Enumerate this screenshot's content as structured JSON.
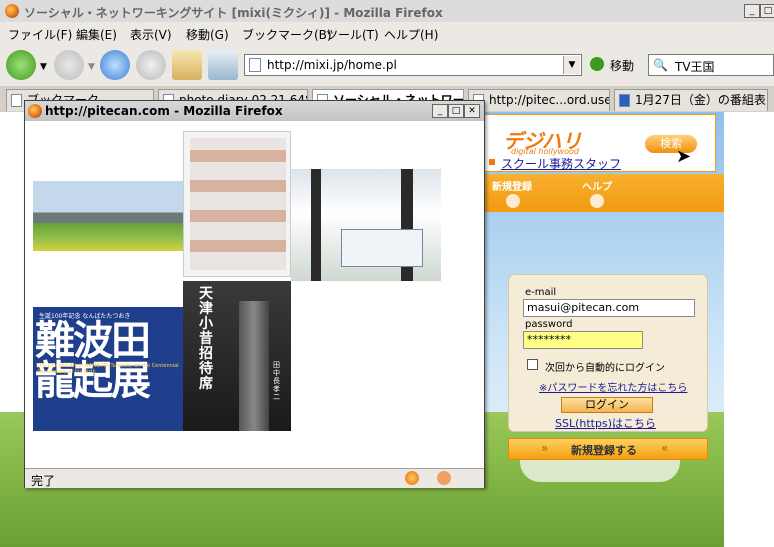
{
  "browser": {
    "main_title": "ソーシャル・ネットワーキングサイト [mixi(ミクシィ)] - Mozilla Firefox",
    "menu": [
      "ファイル(F)",
      "編集(E)",
      "表示(V)",
      "移動(G)",
      "ブックマーク(B)",
      "ツール(T)",
      "ヘルプ(H)"
    ],
    "url": "http://mixi.jp/home.pl",
    "go_label": "移動",
    "search_value": "TV王国",
    "tabs": [
      "ブックマーク",
      "photo diary 02.21.648",
      "ソーシャル・ネットワー",
      "http://pitec...ord.user.js",
      "1月27日（金）の番組表..."
    ]
  },
  "mixi": {
    "logo_text": "デジハリ",
    "logo_sub": "digital hollywood",
    "search_button": "検索",
    "staff_link": "スクール事務スタッフ",
    "nav_register": "新規登録",
    "nav_help": "ヘルプ",
    "email_label": "e-mail",
    "email_value": "masui@pitecan.com",
    "password_label": "password",
    "password_value": "********",
    "auto_login_label": "次回から自動的にログイン",
    "forgot_link": "※パスワードを忘れた方はこちら",
    "login_button": "ログイン",
    "ssl_link": "SSL(https)はこちら",
    "register_button": "新規登録する"
  },
  "popup": {
    "title": "http://pitecan.com - Mozilla Firefox",
    "status": "完了",
    "book_title_main": "難波田 龍起展",
    "book_caption": "生誕100年記念 なんばたたつおき",
    "book_subtitle": "The Life and Art of NAMBATA Tatsuoki, on the Centennial Anniversary of his Birth",
    "book2_title": "天津小昔 招待席",
    "book2_author": "田中長孝二"
  }
}
